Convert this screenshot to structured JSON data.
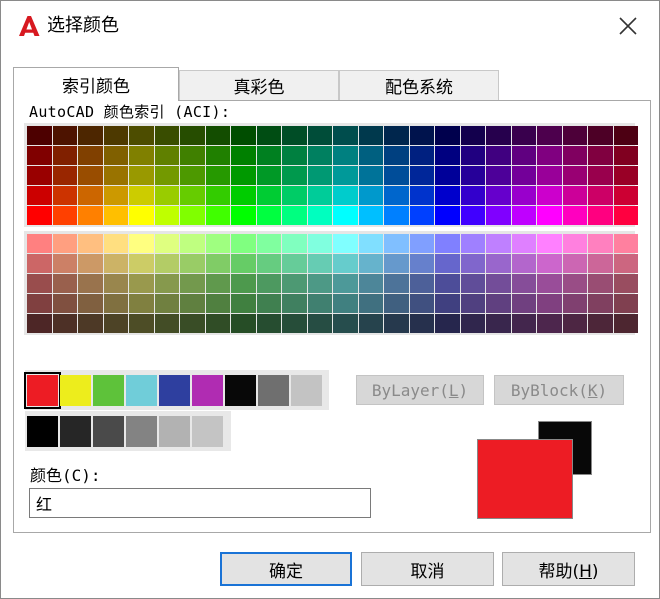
{
  "window": {
    "title": "选择颜色"
  },
  "tabs": [
    {
      "label": "索引颜色",
      "active": true
    },
    {
      "label": "真彩色",
      "active": false
    },
    {
      "label": "配色系统",
      "active": false
    }
  ],
  "aci_label": "AutoCAD 颜色索引 (ACI):",
  "standard_colors": [
    "#ed1c24",
    "#eded1c",
    "#5ec23a",
    "#70cdd9",
    "#2e3f9f",
    "#b02cb2",
    "#080808",
    "#6f6f6f",
    "#c3c3c3"
  ],
  "selected_standard_index": 0,
  "gray_colors": [
    "#000000",
    "#262626",
    "#4a4a4a",
    "#838383",
    "#b2b2b2",
    "#c4c4c4"
  ],
  "buttons": {
    "bylayer": {
      "text": "ByLayer(",
      "key": "L",
      "end": ")"
    },
    "byblock": {
      "text": "ByBlock(",
      "key": "K",
      "end": ")"
    },
    "ok": {
      "label": "确定"
    },
    "cancel": {
      "label": "取消"
    },
    "help": {
      "text": "帮助(",
      "key": "H",
      "end": ")"
    }
  },
  "color_field": {
    "label": "颜色(C):",
    "value": "红"
  },
  "preview": {
    "new_color": "#ed1c24",
    "old_color": "#080808"
  },
  "colors": {
    "accent": "#1a73d6",
    "app_red": "#d71920"
  }
}
